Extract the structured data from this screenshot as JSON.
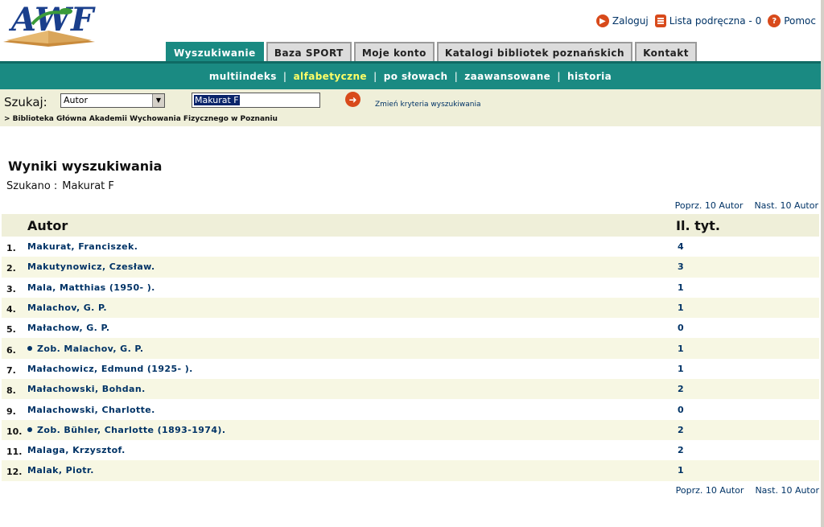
{
  "logo": {
    "alt": "AWF"
  },
  "toplinks": [
    {
      "label": "Zaloguj",
      "icon": "play-icon"
    },
    {
      "label": "Lista podręczna - 0",
      "icon": "list-icon"
    },
    {
      "label": "Pomoc",
      "icon": "help-icon"
    }
  ],
  "tabs": [
    "Wyszukiwanie",
    "Baza SPORT",
    "Moje konto",
    "Katalogi bibliotek poznańskich",
    "Kontakt"
  ],
  "subnav": [
    "multiindeks",
    "alfabetyczne",
    "po słowach",
    "zaawansowane",
    "historia"
  ],
  "search": {
    "label": "Szukaj:",
    "field_value": "Autor",
    "query": "Makurat F",
    "change_criteria": "Zmień kryteria wyszukiwania",
    "library": "> Biblioteka Główna Akademii Wychowania Fizycznego w Poznaniu"
  },
  "results": {
    "title": "Wyniki wyszukiwania",
    "sought_label": "Szukano :",
    "sought_value": "Makurat F",
    "prev": "Poprz. 10 Autor",
    "next": "Nast. 10 Autor",
    "col_autor": "Autor",
    "col_count": "Il. tyt.",
    "rows": [
      {
        "n": "1.",
        "autor": "Makurat, Franciszek.",
        "count": "4",
        "see": false
      },
      {
        "n": "2.",
        "autor": "Makutynowicz, Czesław.",
        "count": "3",
        "see": false
      },
      {
        "n": "3.",
        "autor": "Mala, Matthias (1950- ).",
        "count": "1",
        "see": false
      },
      {
        "n": "4.",
        "autor": "Malachov, G. P.",
        "count": "1",
        "see": false
      },
      {
        "n": "5.",
        "autor": "Małachow, G. P.",
        "count": "0",
        "see": false
      },
      {
        "n": "6.",
        "autor": "Zob. Malachov, G. P.",
        "count": "1",
        "see": true
      },
      {
        "n": "7.",
        "autor": "Małachowicz, Edmund (1925- ).",
        "count": "1",
        "see": false
      },
      {
        "n": "8.",
        "autor": "Małachowski, Bohdan.",
        "count": "2",
        "see": false
      },
      {
        "n": "9.",
        "autor": "Malachowski, Charlotte.",
        "count": "0",
        "see": false
      },
      {
        "n": "10.",
        "autor": "Zob. Bühler, Charlotte (1893-1974).",
        "count": "2",
        "see": true
      },
      {
        "n": "11.",
        "autor": "Malaga, Krzysztof.",
        "count": "2",
        "see": false
      },
      {
        "n": "12.",
        "autor": "Malak, Piotr.",
        "count": "1",
        "see": false
      }
    ]
  }
}
